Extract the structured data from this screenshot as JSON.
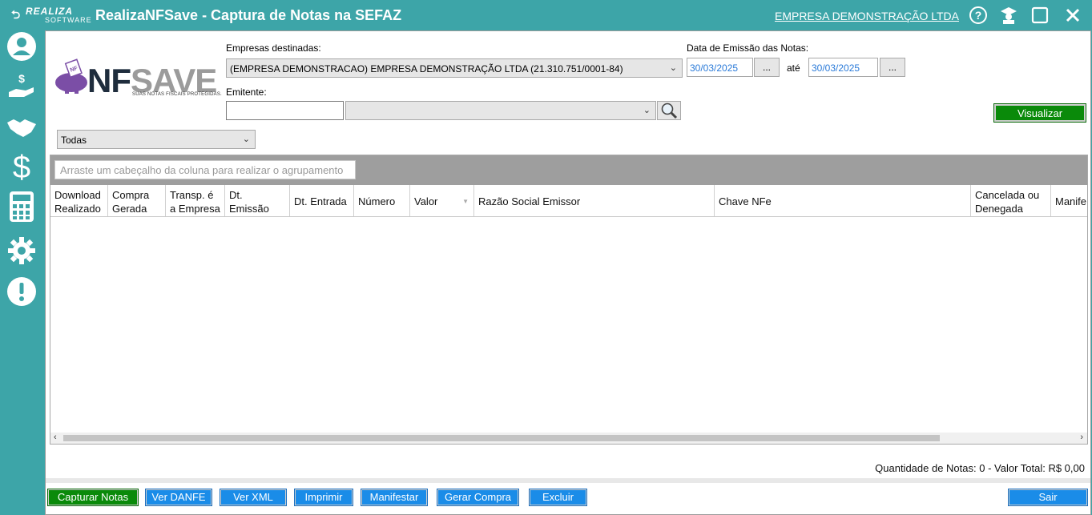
{
  "titlebar": {
    "brand": "REALIZA",
    "brand_sub": "SOFTWARE",
    "title": "RealizaNFSave -  Captura de Notas na SEFAZ",
    "company_link": "EMPRESA DEMONSTRAÇÃO LTDA",
    "icons": [
      "help-icon",
      "graduate-icon",
      "maximize-icon",
      "close-icon"
    ]
  },
  "sidebar": {
    "icons": [
      "user-icon",
      "money-hand-icon",
      "handshake-icon",
      "dollar-icon",
      "calculator-icon",
      "gear-icon",
      "alert-icon"
    ]
  },
  "logo": {
    "nf": "NF",
    "save": "SAVE",
    "tagline": "SUAS NOTAS FISCAIS PROTEGIDAS."
  },
  "filters": {
    "empresas_label": "Empresas destinadas:",
    "empresa_selected": "(EMPRESA DEMONSTRACAO) EMPRESA DEMONSTRAÇÃO LTDA (21.310.751/0001-84)",
    "data_label": "Data de Emissão das Notas:",
    "date_from": "30/03/2025",
    "date_to": "30/03/2025",
    "date_btn": "...",
    "ate_label": "até",
    "emitente_label": "Emitente:",
    "emitente_value": "",
    "emitente_select": "",
    "visualizar": "Visualizar",
    "status_selected": "Todas"
  },
  "grid": {
    "group_hint": "Arraste um cabeçalho da coluna para realizar o agrupamento",
    "columns": [
      {
        "l1": "Download",
        "l2": "Realizado"
      },
      {
        "l1": "Compra",
        "l2": "Gerada"
      },
      {
        "l1": "Transp. é",
        "l2": "a Empresa"
      },
      {
        "l1": "Dt.",
        "l2": "Emissão"
      },
      {
        "l1": "Dt. Entrada",
        "l2": ""
      },
      {
        "l1": "Número",
        "l2": ""
      },
      {
        "l1": "Valor",
        "l2": ""
      },
      {
        "l1": "Razão Social Emissor",
        "l2": ""
      },
      {
        "l1": "Chave NFe",
        "l2": ""
      },
      {
        "l1": "Cancelada ou",
        "l2": "Denegada"
      },
      {
        "l1": "Manife",
        "l2": ""
      }
    ]
  },
  "summary": "Quantidade de Notas: 0 - Valor Total: R$ 0,00",
  "actions": {
    "capturar": "Capturar Notas",
    "danfe": "Ver DANFE",
    "xml": "Ver XML",
    "imprimir": "Imprimir",
    "manifestar": "Manifestar",
    "gerar_compra": "Gerar Compra",
    "excluir": "Excluir",
    "sair": "Sair"
  },
  "colors": {
    "teal": "#3da5a8",
    "green": "#0a8a0a",
    "blue": "#1a8ce8"
  }
}
